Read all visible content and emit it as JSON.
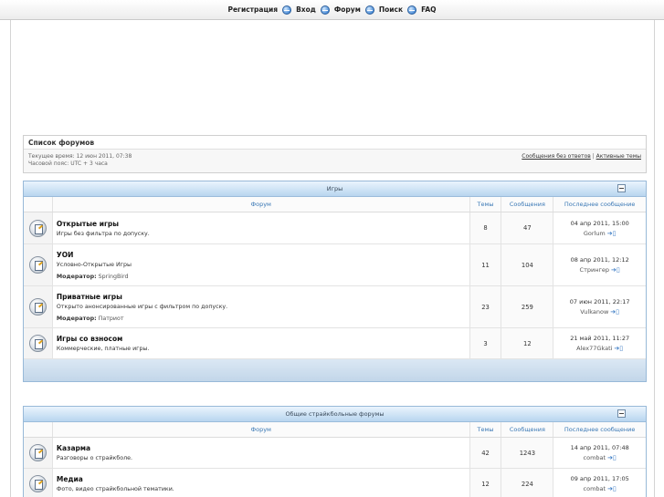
{
  "nav": {
    "items": [
      "Регистрация",
      "Вход",
      "Форум",
      "Поиск",
      "FAQ"
    ]
  },
  "forum_list": {
    "title": "Список форумов",
    "current_time": "Текущее время: 12 июн 2011, 07:38",
    "timezone": "Часовой пояс: UTC + 3 часа",
    "link_unanswered": "Сообщения без ответов",
    "link_separator": " | ",
    "link_active": "Активные темы"
  },
  "columns": {
    "forum": "Форум",
    "topics": "Темы",
    "posts": "Сообщения",
    "last": "Последнее сообщение"
  },
  "moderator_label": "Модератор:",
  "categories": [
    {
      "title": "Игры",
      "forums": [
        {
          "name": "Открытые игры",
          "desc": "Игры без фильтра по допуску.",
          "moderator": "",
          "topics": "8",
          "posts": "47",
          "last_date": "04 апр 2011, 15:00",
          "last_user": "Gorlum"
        },
        {
          "name": "УОИ",
          "desc": "Условно-Открытые Игры",
          "moderator": "SpringBird",
          "topics": "11",
          "posts": "104",
          "last_date": "08 апр 2011, 12:12",
          "last_user": "Стрингер"
        },
        {
          "name": "Приватные игры",
          "desc": "Открыто анонсированные игры с фильтром по допуску.",
          "moderator": "Патриот",
          "topics": "23",
          "posts": "259",
          "last_date": "07 июн 2011, 22:17",
          "last_user": "Vulkanow"
        },
        {
          "name": "Игры со взносом",
          "desc": "Коммерческие, платные игры.",
          "moderator": "",
          "topics": "3",
          "posts": "12",
          "last_date": "21 май 2011, 11:27",
          "last_user": "Alex77Gkati"
        }
      ]
    },
    {
      "title": "Общие страйкбольные форумы",
      "forums": [
        {
          "name": "Казарма",
          "desc": "Разговоры о страйкболе.",
          "moderator": "",
          "topics": "42",
          "posts": "1243",
          "last_date": "14 апр 2011, 07:48",
          "last_user": "combat"
        },
        {
          "name": "Медиа",
          "desc": "Фото, видео страйкбольной тематики.",
          "moderator": "",
          "topics": "12",
          "posts": "224",
          "last_date": "09 апр 2011, 17:05",
          "last_user": "combat"
        }
      ]
    }
  ]
}
